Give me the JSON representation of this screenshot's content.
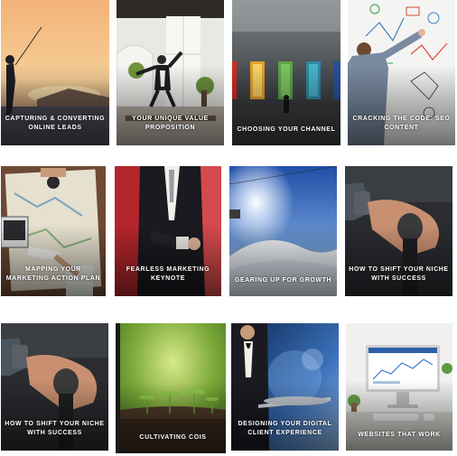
{
  "tiles": [
    {
      "title": "CAPTURING & CONVERTING ONLINE LEADS",
      "image": "man-fishing-at-sunset"
    },
    {
      "title": "YOUR UNIQUE VALUE PROPOSITION",
      "image": "man-jumping-in-office"
    },
    {
      "title": "CHOOSING YOUR CHANNEL",
      "image": "man-facing-colored-doors"
    },
    {
      "title": "CRACKING THE CODE: SEO CONTENT",
      "image": "man-drawing-on-whiteboard"
    },
    {
      "title": "MAPPING YOUR MARKETING ACTION PLAN",
      "image": "people-planning-over-map"
    },
    {
      "title": "FEARLESS MARKETING KEYNOTE",
      "image": "man-in-suit-adjusting-cuff"
    },
    {
      "title": "GEARING UP FOR GROWTH",
      "image": "snowy-mountain-ski-lift"
    },
    {
      "title": "HOW TO SHIFT YOUR NICHE WITH SUCCESS",
      "image": "hand-on-gear-shift"
    },
    {
      "title": "HOW TO SHIFT YOUR NICHE WITH SUCCESS",
      "image": "hand-on-gear-shift"
    },
    {
      "title": "CULTIVATING COIS",
      "image": "seedlings-growing"
    },
    {
      "title": "DESIGNING YOUR DIGITAL CLIENT EXPERIENCE",
      "image": "waiter-holding-tray"
    },
    {
      "title": "WEBSITES THAT WORK",
      "image": "computer-monitor-on-desk"
    }
  ]
}
